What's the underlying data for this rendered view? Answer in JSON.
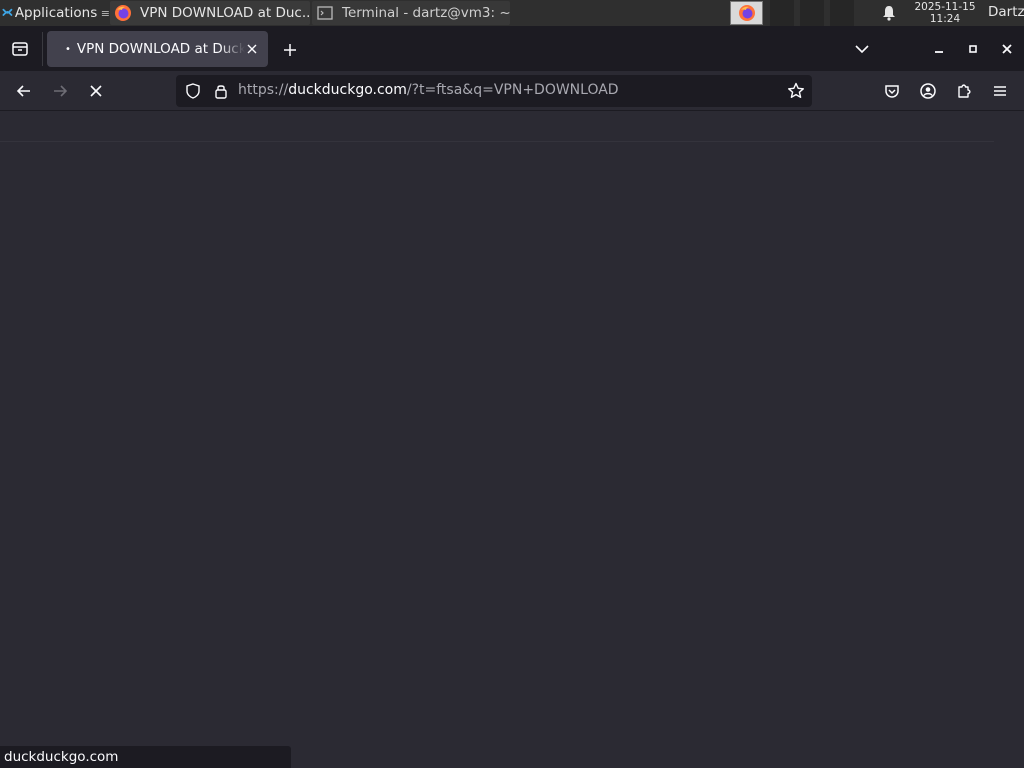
{
  "taskbar": {
    "apps_label": "Applications",
    "tasks": [
      {
        "label": "VPN DOWNLOAD at Duc...",
        "icon": "firefox-icon"
      },
      {
        "label": "Terminal - dartz@vm3: ~",
        "icon": "terminal-icon"
      }
    ],
    "clock_date": "2025-11-15",
    "clock_time": "11:24",
    "user": "Dartz"
  },
  "browser": {
    "tab_title": "VPN DOWNLOAD at DuckDuckGo",
    "url_domain": "duckduckgo.com",
    "url_prefix": "https://",
    "url_rest": "/?t=ftsa&q=VPN+DOWNLOAD",
    "status_text": "duckduckgo.com"
  },
  "colors": {
    "toolbar": "#2b2a33",
    "tabstrip": "#1c1b22",
    "active_tab": "#42414d",
    "text": "#fbfbfe"
  }
}
